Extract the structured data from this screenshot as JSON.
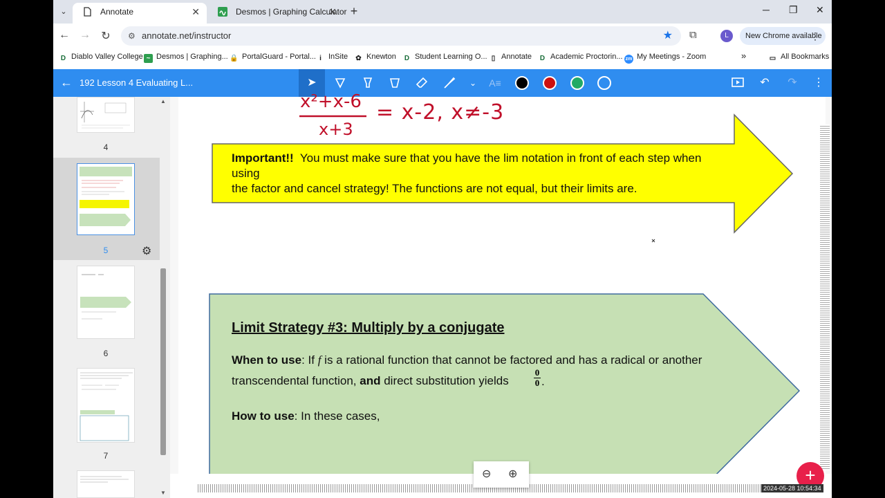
{
  "browser": {
    "tabs": [
      {
        "label": "Annotate",
        "active": true
      },
      {
        "label": "Desmos | Graphing Calculator",
        "active": false
      }
    ],
    "url": "annotate.net/instructor",
    "update_label": "New Chrome available",
    "avatar_letter": "L"
  },
  "bookmarks": [
    {
      "label": "Diablo Valley College",
      "icon": "dvc-icon"
    },
    {
      "label": "Desmos | Graphing...",
      "icon": "desmos-icon"
    },
    {
      "label": "PortalGuard - Portal...",
      "icon": "lock-icon"
    },
    {
      "label": "InSite",
      "icon": "insite-icon"
    },
    {
      "label": "Knewton",
      "icon": "knewton-icon"
    },
    {
      "label": "Student Learning O...",
      "icon": "dvc-icon"
    },
    {
      "label": "Annotate",
      "icon": "page-icon"
    },
    {
      "label": "Academic Proctorin...",
      "icon": "dvc-icon"
    },
    {
      "label": "My Meetings - Zoom",
      "icon": "zoom-icon"
    }
  ],
  "all_bookmarks": "All Bookmarks",
  "annotate": {
    "doc_title": "192 Lesson 4 Evaluating L...",
    "colors": [
      "#000000",
      "#cc1111",
      "#22aa66",
      "#2f8df0"
    ]
  },
  "pages": [
    {
      "num": "4"
    },
    {
      "num": "5",
      "selected": true
    },
    {
      "num": "6"
    },
    {
      "num": "7"
    }
  ],
  "content": {
    "handwritten_lhs_num": "x²+x-6",
    "handwritten_lhs_den": "x+3",
    "handwritten_rhs": "= x-2, x≠-3",
    "important_bold": "Important!!",
    "important_line1": "You must make sure that you have the lim notation in front of each step when using",
    "important_line2": "the factor and cancel strategy!  The functions are not equal, but their limits are.",
    "strategy_title": "Limit Strategy #3:  Multiply by a conjugate",
    "when_bold": "When to use",
    "when_text1a": ":  If",
    "when_f": "f",
    "when_text1b": "is a rational function that cannot be factored and has a radical or another",
    "when_text2a": "transcendental function,",
    "when_and": "and",
    "when_text2b": "direct substitution yields",
    "frac_num": "0",
    "frac_den": "0",
    "how_bold": "How to use",
    "how_text": ":  In these cases,"
  },
  "timestamp": "2024-05-28  10:54:34"
}
